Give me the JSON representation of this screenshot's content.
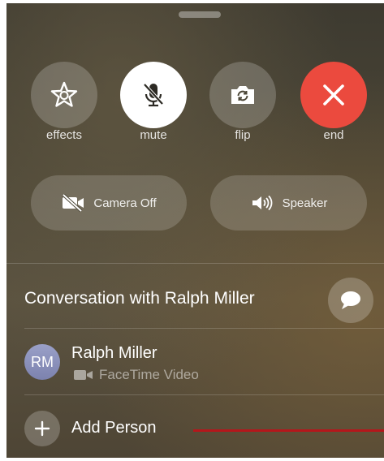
{
  "controls": [
    {
      "label": "effects",
      "icon": "effects-star-icon"
    },
    {
      "label": "mute",
      "icon": "mic-slash-icon",
      "active": true
    },
    {
      "label": "flip",
      "icon": "camera-rotate-icon"
    },
    {
      "label": "end",
      "icon": "close-icon",
      "color": "#eb4a3e"
    }
  ],
  "toggles": {
    "camera": {
      "label": "Camera Off",
      "icon": "video-slash-icon"
    },
    "speaker": {
      "label": "Speaker",
      "icon": "speaker-wave-icon"
    }
  },
  "conversation": {
    "title": "Conversation with Ralph Miller",
    "message_icon": "message-bubble-icon"
  },
  "participants": [
    {
      "initials": "RM",
      "name": "Ralph Miller",
      "status": "FaceTime Video",
      "status_icon": "video-icon"
    }
  ],
  "add_person": {
    "label": "Add Person",
    "icon": "plus-icon"
  },
  "colors": {
    "end_call": "#eb4a3e",
    "annotation_line": "#b5161b"
  }
}
